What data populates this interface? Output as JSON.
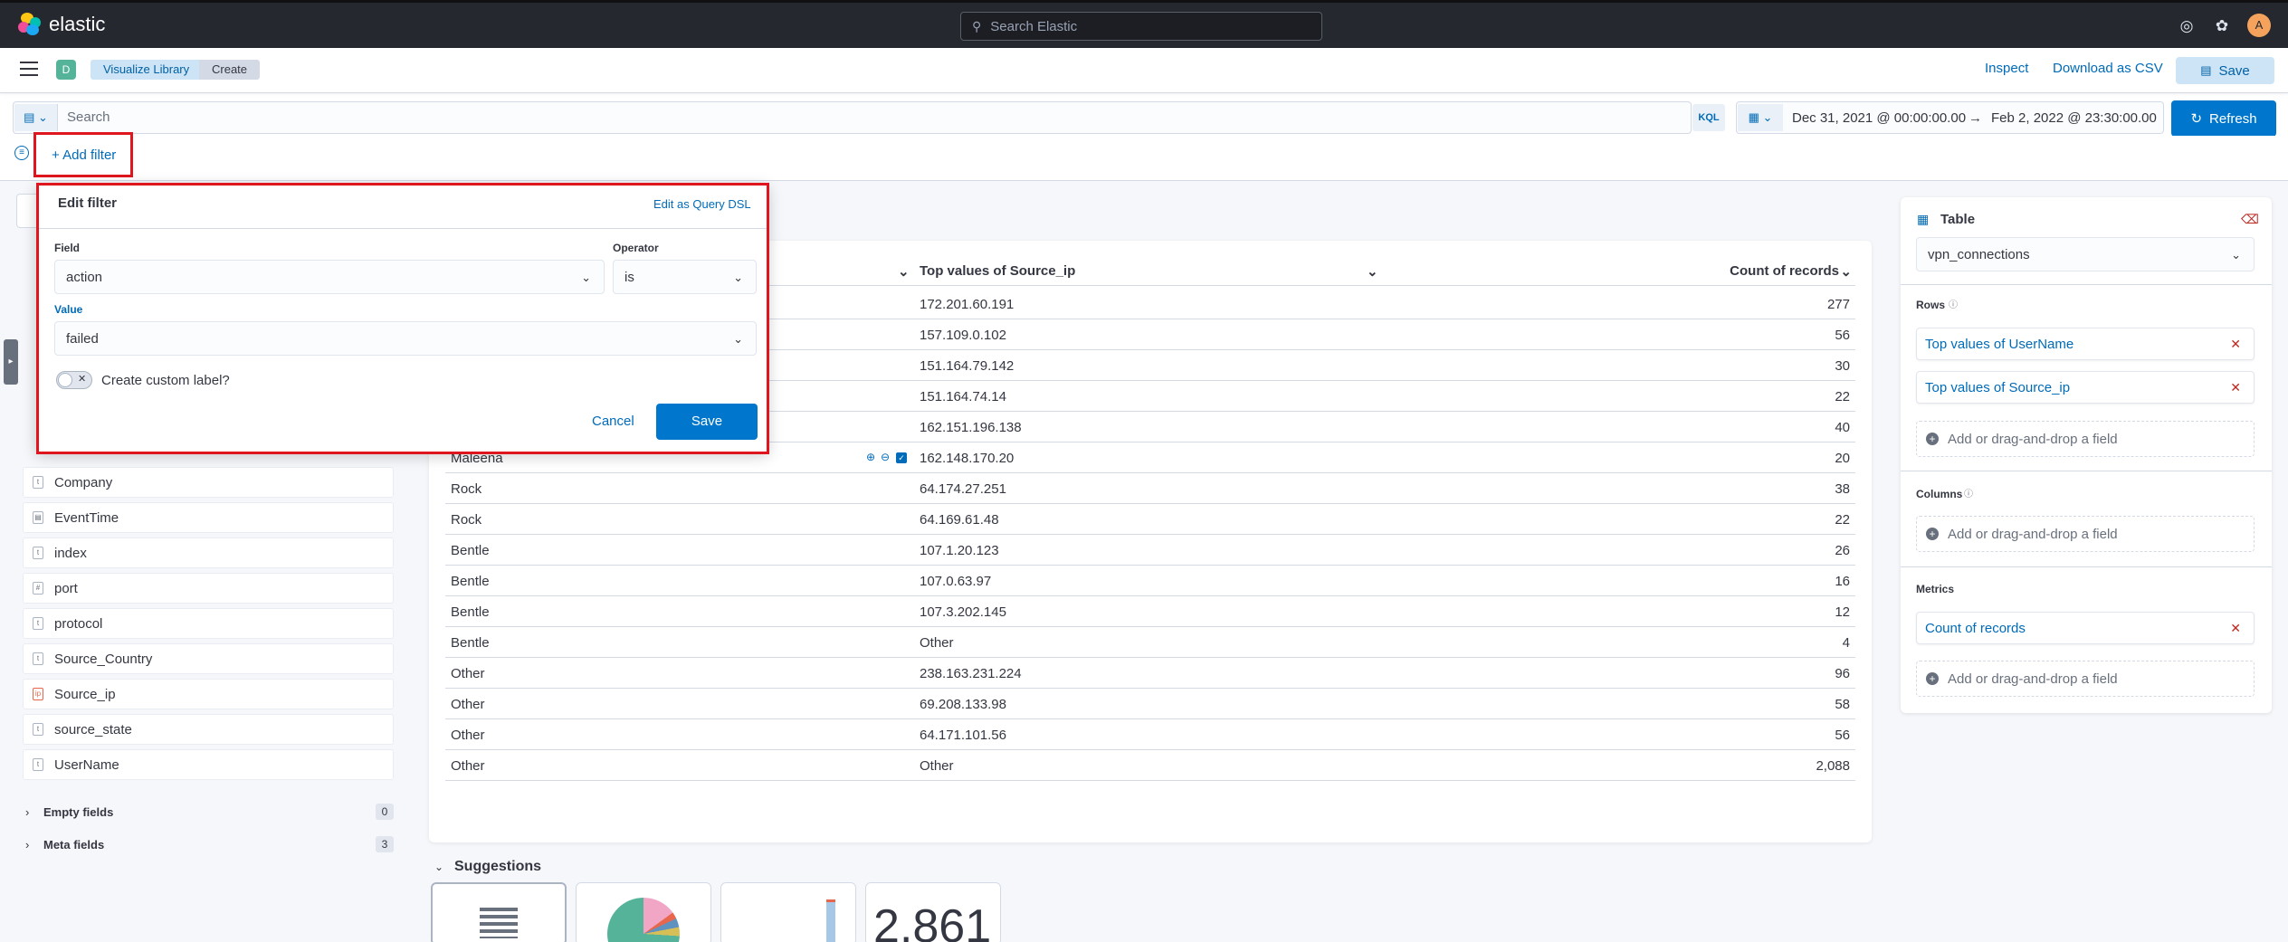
{
  "topbar": {
    "brand": "elastic",
    "search_placeholder": "Search Elastic",
    "avatar_initial": "A"
  },
  "header": {
    "space_initial": "D",
    "breadcrumbs": [
      "Visualize Library",
      "Create"
    ],
    "inspect": "Inspect",
    "download_csv": "Download as CSV",
    "save": "Save"
  },
  "query": {
    "placeholder": "Search",
    "language": "KQL",
    "date_from": "Dec 31, 2021 @ 00:00:00.00",
    "date_arrow": "→",
    "date_to": "Feb 2, 2022 @ 23:30:00.00",
    "refresh": "Refresh"
  },
  "filters": {
    "add_filter": "+ Add filter"
  },
  "edit_filter": {
    "title": "Edit filter",
    "edit_dsl": "Edit as Query DSL",
    "field_label": "Field",
    "field_value": "action",
    "operator_label": "Operator",
    "operator_value": "is",
    "value_label": "Value",
    "value_value": "failed",
    "custom_label": "Create custom label?",
    "cancel": "Cancel",
    "save": "Save"
  },
  "sidebar": {
    "fields": [
      {
        "name": "Company",
        "type": "t"
      },
      {
        "name": "EventTime",
        "type": "date"
      },
      {
        "name": "index",
        "type": "t"
      },
      {
        "name": "port",
        "type": "#"
      },
      {
        "name": "protocol",
        "type": "t"
      },
      {
        "name": "Source_Country",
        "type": "t"
      },
      {
        "name": "Source_ip",
        "type": "ip"
      },
      {
        "name": "source_state",
        "type": "t"
      },
      {
        "name": "UserName",
        "type": "t"
      }
    ],
    "empty_fields": "Empty fields",
    "empty_count": "0",
    "meta_fields": "Meta fields",
    "meta_count": "3"
  },
  "table": {
    "headers": [
      "",
      "Top values of Source_ip",
      "Count of records"
    ],
    "rows": [
      [
        "",
        "172.201.60.191",
        "277"
      ],
      [
        "",
        "157.109.0.102",
        "56"
      ],
      [
        "",
        "151.164.79.142",
        "30"
      ],
      [
        "",
        "151.164.74.14",
        "22"
      ],
      [
        "",
        "162.151.196.138",
        "40"
      ],
      [
        "Maleena",
        "162.148.170.20",
        "20"
      ],
      [
        "Rock",
        "64.174.27.251",
        "38"
      ],
      [
        "Rock",
        "64.169.61.48",
        "22"
      ],
      [
        "Bentle",
        "107.1.20.123",
        "26"
      ],
      [
        "Bentle",
        "107.0.63.97",
        "16"
      ],
      [
        "Bentle",
        "107.3.202.145",
        "12"
      ],
      [
        "Bentle",
        "Other",
        "4"
      ],
      [
        "Other",
        "238.163.231.224",
        "96"
      ],
      [
        "Other",
        "69.208.133.98",
        "58"
      ],
      [
        "Other",
        "64.171.101.56",
        "56"
      ],
      [
        "Other",
        "Other",
        "2,088"
      ]
    ]
  },
  "suggestions": {
    "title": "Suggestions",
    "metric_preview": "2,861"
  },
  "config": {
    "type": "Table",
    "datasource": "vpn_connections",
    "rows_label": "Rows",
    "rows": [
      "Top values of UserName",
      "Top values of Source_ip"
    ],
    "columns_label": "Columns",
    "metrics_label": "Metrics",
    "metrics": [
      "Count of records"
    ],
    "drop_hint": "Add or drag-and-drop a field"
  }
}
